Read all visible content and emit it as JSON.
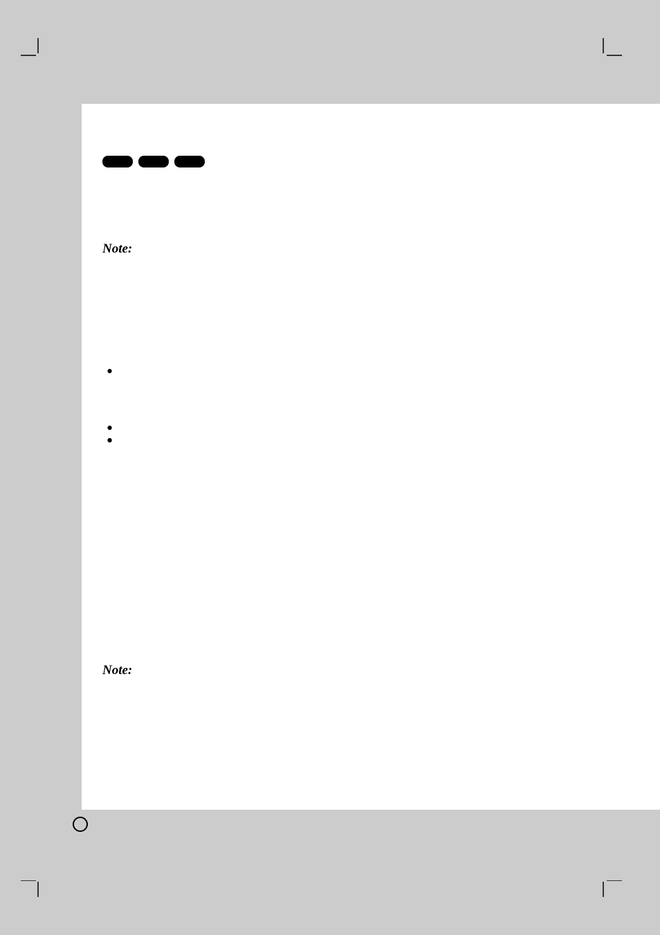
{
  "notes": {
    "note1": "Note:",
    "note2": "Note:"
  },
  "bullets": {
    "item1": "",
    "item2": "",
    "item3": "",
    "item4": ""
  },
  "decorations": {
    "pillCount": 3,
    "circleMarker": true
  }
}
